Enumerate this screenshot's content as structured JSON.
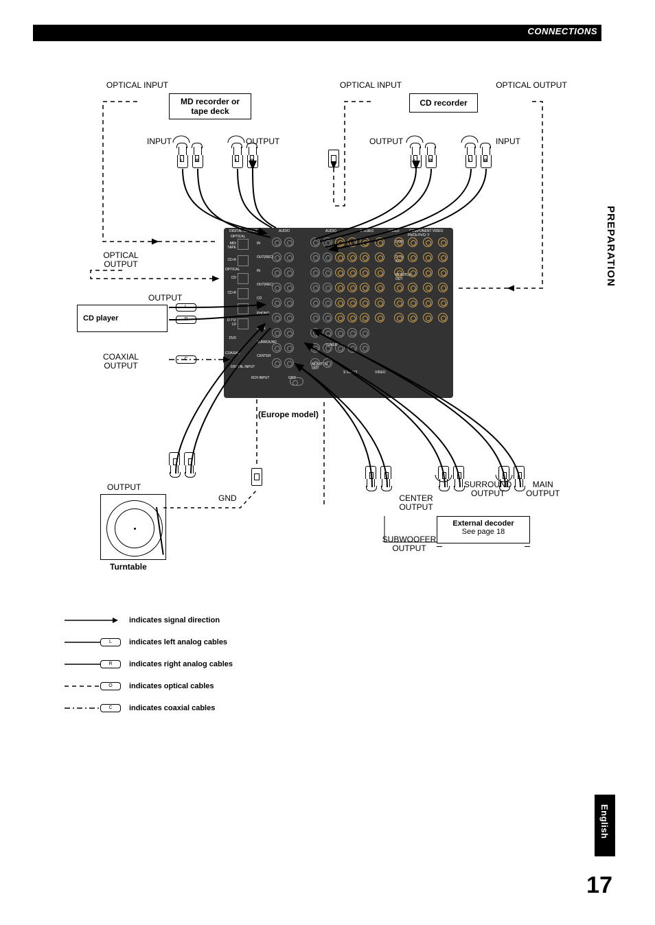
{
  "header": {
    "section": "CONNECTIONS"
  },
  "side": {
    "tab": "PREPARATION",
    "lang": "English"
  },
  "page": "17",
  "labels": {
    "opt_in_left": "OPTICAL\nINPUT",
    "opt_in_mid": "OPTICAL\nINPUT",
    "opt_out_right": "OPTICAL\nOUTPUT",
    "opt_out_left": "OPTICAL\nOUTPUT",
    "coax_out": "COAXIAL\nOUTPUT",
    "input": "INPUT",
    "output": "OUTPUT",
    "gnd": "GND",
    "center_out": "CENTER\nOUTPUT",
    "surround_out": "SURROUND\nOUTPUT",
    "main_out": "MAIN\nOUTPUT",
    "sub_out": "SUBWOOFER\nOUTPUT",
    "europe": "(Europe model)",
    "turntable": "Turntable"
  },
  "boxes": {
    "md": "MD recorder or\ntape deck",
    "cdr": "CD recorder",
    "cdp": "CD player",
    "ext1": "External decoder",
    "ext2": "See page 18"
  },
  "legend": {
    "sig": "indicates signal direction",
    "left": "indicates left analog cables",
    "right": "indicates right analog cables",
    "opt": "indicates optical cables",
    "coax": "indicates coaxial cables"
  },
  "legend_sym": {
    "l": "L",
    "r": "R",
    "o": "O",
    "c": "C"
  },
  "rca_labels": {
    "l": "L",
    "r": "R"
  }
}
